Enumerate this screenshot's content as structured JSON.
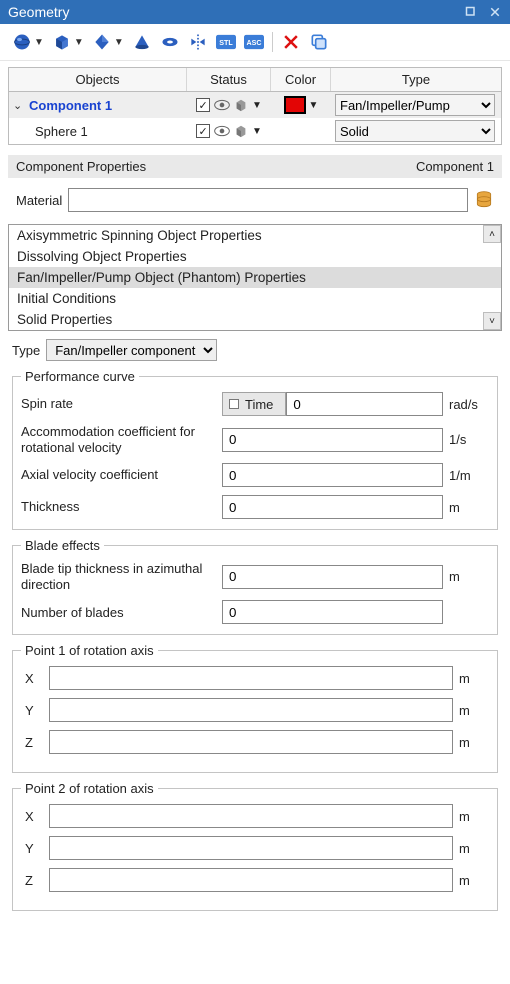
{
  "title": "Geometry",
  "toolbar_icons": [
    "sphere",
    "box",
    "diamond",
    "cone",
    "torus",
    "mirror",
    "stl",
    "asc",
    "delete",
    "copy"
  ],
  "grid": {
    "headers": [
      "Objects",
      "Status",
      "Color",
      "Type"
    ],
    "rows": [
      {
        "name": "Component 1",
        "expanded": true,
        "selected": true,
        "boldBlue": true,
        "checked": true,
        "color": "#e30505",
        "type": "Fan/Impeller/Pump"
      },
      {
        "name": "Sphere 1",
        "indent": true,
        "checked": true,
        "color": null,
        "type": "Solid"
      }
    ]
  },
  "section": {
    "left": "Component Properties",
    "right": "Component 1"
  },
  "material": {
    "label": "Material",
    "value": ""
  },
  "prop_list": {
    "items": [
      "Axisymmetric Spinning Object Properties",
      "Dissolving Object Properties",
      "Fan/Impeller/Pump Object (Phantom) Properties",
      "Initial Conditions",
      "Solid Properties"
    ],
    "selected_index": 2
  },
  "type_select": {
    "label": "Type",
    "value": "Fan/Impeller component"
  },
  "perf": {
    "legend": "Performance curve",
    "spin_label": "Spin rate",
    "time_label": "Time",
    "spin_value": "0",
    "spin_unit": "rad/s",
    "accom_label": "Accommodation coefficient for rotational velocity",
    "accom_value": "0",
    "accom_unit": "1/s",
    "axial_label": "Axial velocity coefficient",
    "axial_value": "0",
    "axial_unit": "1/m",
    "thick_label": "Thickness",
    "thick_value": "0",
    "thick_unit": "m"
  },
  "blade": {
    "legend": "Blade effects",
    "tip_label": "Blade tip thickness in azimuthal direction",
    "tip_value": "0",
    "tip_unit": "m",
    "num_label": "Number of blades",
    "num_value": "0"
  },
  "p1": {
    "legend": "Point 1 of rotation axis",
    "x": "",
    "y": "",
    "z": "",
    "unit": "m"
  },
  "p2": {
    "legend": "Point 2 of rotation axis",
    "x": "",
    "y": "",
    "z": "",
    "unit": "m"
  },
  "labels": {
    "x": "X",
    "y": "Y",
    "z": "Z"
  }
}
